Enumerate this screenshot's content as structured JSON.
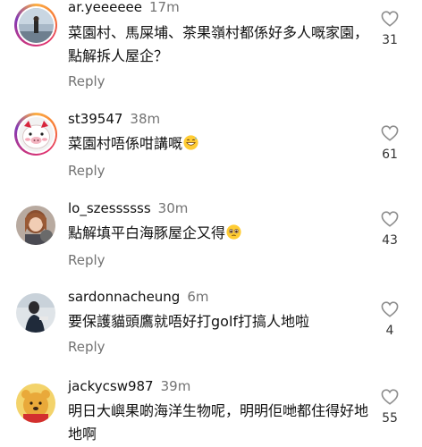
{
  "comments": [
    {
      "username": "ar.yeeeeee",
      "time": "17m",
      "text": "菜園村、馬屎埔、茶果嶺村都係好多人嘅家園，點解拆人屋企？",
      "emoji": "",
      "reply_label": "Reply",
      "likes": "31"
    },
    {
      "username": "st39547",
      "time": "38m",
      "text": "菜園村唔係咁講嘅",
      "emoji": "grinning-sweat-emoji",
      "reply_label": "Reply",
      "likes": "61"
    },
    {
      "username": "lo_szessssss",
      "time": "30m",
      "text": "點解填平白海豚屋企又得",
      "emoji": "pleading-face-emoji",
      "reply_label": "Reply",
      "likes": "43"
    },
    {
      "username": "sardonnacheung",
      "time": "6m",
      "text": "要保護貓頭鷹就唔好打golf打搞人地啦",
      "emoji": "",
      "reply_label": "Reply",
      "likes": "4"
    },
    {
      "username": "jackycsw987",
      "time": "39m",
      "text": "明日大嶼果啲海洋生物呢，明明佢哋都住得好地地啊",
      "emoji": "",
      "reply_label": "",
      "likes": "55"
    }
  ],
  "colors": {
    "secondary_text": "#737373",
    "primary_text": "#111111",
    "heart_outline": "#8e8e8e"
  }
}
